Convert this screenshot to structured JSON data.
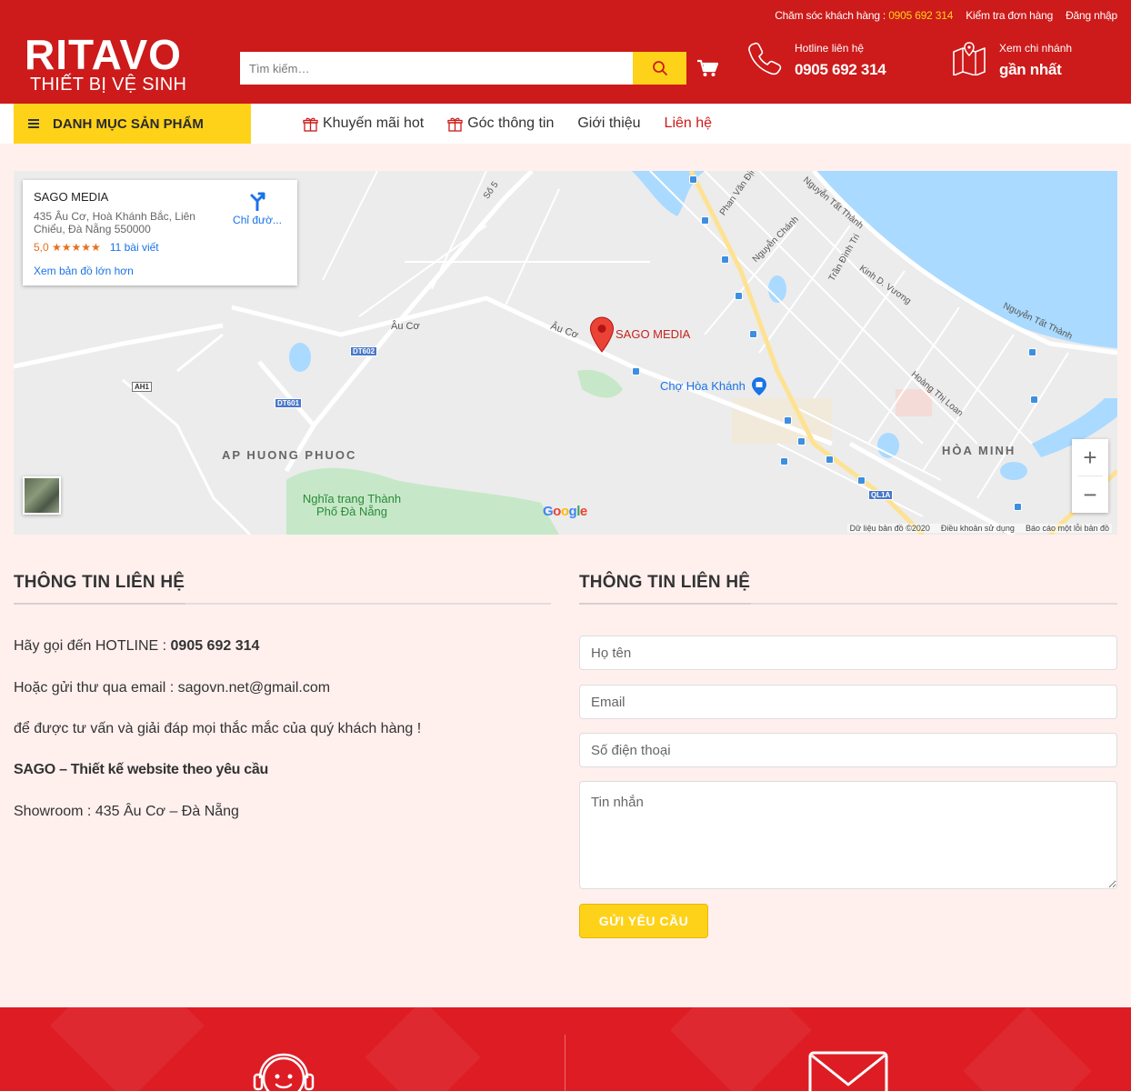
{
  "header": {
    "support_label": "Chăm sóc khách hàng :",
    "support_phone": "0905 692 314",
    "check_order": "Kiểm tra đơn hàng",
    "login": "Đăng nhập",
    "logo_main": "RITAVO",
    "logo_sub": "THIẾT BỊ VỆ SINH",
    "search_placeholder": "Tìm kiếm…",
    "hotline_label": "Hotline liên hệ",
    "hotline_number": "0905 692 314",
    "branch_label": "Xem chi nhánh",
    "branch_value": "gần nhất"
  },
  "nav": {
    "category_menu": "DANH MỤC SẢN PHẨM",
    "items": [
      {
        "label": "Khuyến mãi hot"
      },
      {
        "label": "Góc thông tin"
      },
      {
        "label": "Giới thiệu"
      },
      {
        "label": "Liên hệ"
      }
    ]
  },
  "map": {
    "card_title": "SAGO MEDIA",
    "card_address": "435 Âu Cơ, Hoà Khánh Bắc, Liên Chiểu, Đà Nẵng 550000",
    "card_rating": "5,0 ★★★★★",
    "card_reviews": "11 bài viết",
    "card_big_map": "Xem bản đồ lớn hơn",
    "card_directions": "Chỉ đườ...",
    "marker_label": "SAGO MEDIA",
    "poi_market": "Chợ Hòa Khánh",
    "area_ap_huong_phuoc": "AP HUONG PHUOC",
    "area_hoa_minh": "HÒA MINH",
    "cemetery": "Nghĩa trang Thành Phố Đà Nẵng",
    "street_au_co": "Âu Cơ",
    "street_nguyen_tat_thanh": "Nguyễn Tất Thành",
    "street_phan_van_dinh": "Phan Văn Định",
    "street_nguyen_chanh": "Nguyễn Chánh",
    "street_tran_dinh_tri": "Trần Đình Tri",
    "street_kinh_d_vuong": "Kinh D. Vương",
    "street_hoang_thi_loan": "Hoàng Thị Loan",
    "street_so5": "Số 5",
    "tag_dt602": "DT602",
    "tag_dt601": "DT601",
    "tag_ah1": "AH1",
    "tag_ql1a": "QL1A",
    "google": "Google",
    "footer_data": "Dữ liệu bản đồ ©2020",
    "footer_terms": "Điều khoản sử dụng",
    "footer_report": "Báo cáo một lỗi bản đồ"
  },
  "contact_info": {
    "title": "THÔNG TIN LIÊN HỆ",
    "hotline_prefix": "Hãy gọi đến HOTLINE : ",
    "hotline": "0905 692 314",
    "email_line": "Hoặc gửi thư qua email : sagovn.net@gmail.com",
    "advice_line": "để được tư vấn và giải đáp mọi thắc mắc của quý khách hàng !",
    "tagline": "SAGO – Thiết kế website theo yêu cầu",
    "showroom": "Showroom : 435 Âu Cơ – Đà Nẵng"
  },
  "contact_form": {
    "title": "THÔNG TIN LIÊN HỆ",
    "name_placeholder": "Họ tên",
    "email_placeholder": "Email",
    "phone_placeholder": "Số điện thoại",
    "message_placeholder": "Tin nhắn",
    "submit": "GỬI YÊU CẦU"
  },
  "colors": {
    "brand_red": "#cd1a1a",
    "accent_yellow": "#ffd21a",
    "page_bg": "#fff0ee",
    "footer_red": "#de1c24"
  },
  "icons": [
    "search-icon",
    "cart-icon",
    "phone-icon",
    "map-icon",
    "gift-icon",
    "menu-icon",
    "headset-icon",
    "envelope-icon",
    "directions-icon",
    "map-marker-icon"
  ]
}
